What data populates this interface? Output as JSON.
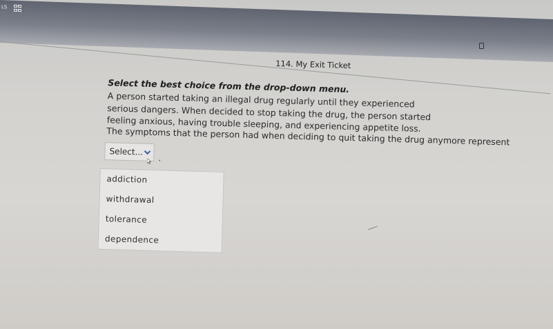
{
  "topbar": {
    "app_label": "LS"
  },
  "question": {
    "header_title": "114. My Exit Ticket",
    "instruction": "Select the best choice from the drop-down menu.",
    "body": "A person started taking an illegal drug regularly until they experienced serious dangers. When decided to stop taking the drug, the person started feeling anxious, having trouble sleeping, and experiencing appetite loss.",
    "prompt": "The symptoms that the person had when deciding to quit taking the drug anymore represent",
    "period": "."
  },
  "select": {
    "value": "Select...",
    "options": [
      "addiction",
      "withdrawal",
      "tolerance",
      "dependence"
    ]
  },
  "icons": {
    "grid": "grid-icon",
    "document": "document-icon",
    "chevron": "chevron-down-icon",
    "cursor": "mouse-cursor-icon"
  }
}
